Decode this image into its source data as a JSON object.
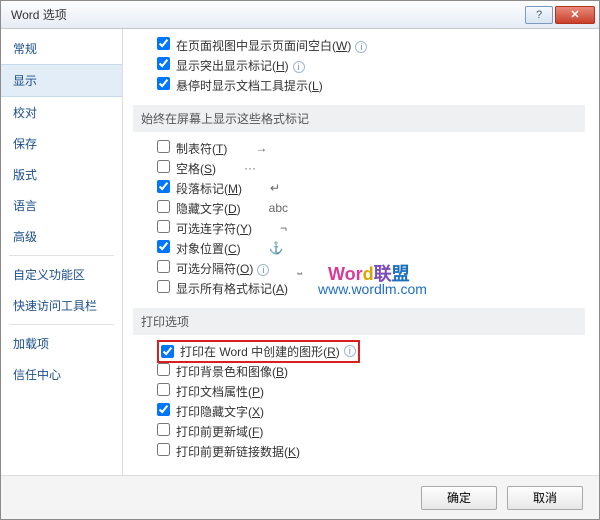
{
  "title": "Word 选项",
  "sidebar": {
    "items": [
      {
        "label": "常规"
      },
      {
        "label": "显示"
      },
      {
        "label": "校对"
      },
      {
        "label": "保存"
      },
      {
        "label": "版式"
      },
      {
        "label": "语言"
      },
      {
        "label": "高级"
      },
      {
        "label": "自定义功能区"
      },
      {
        "label": "快速访问工具栏"
      },
      {
        "label": "加载项"
      },
      {
        "label": "信任中心"
      }
    ]
  },
  "top_opts": [
    {
      "checked": true,
      "label": "在页面视图中显示页面间空白(",
      "key": "W",
      "tail": ")",
      "info": true
    },
    {
      "checked": true,
      "label": "显示突出显示标记(",
      "key": "H",
      "tail": ")",
      "info": true
    },
    {
      "checked": true,
      "label": "悬停时显示文档工具提示(",
      "key": "L",
      "tail": ")"
    }
  ],
  "section1": "始终在屏幕上显示这些格式标记",
  "fmt_opts": [
    {
      "checked": false,
      "label": "制表符(",
      "key": "T",
      "tail": ")",
      "sym": "→"
    },
    {
      "checked": false,
      "label": "空格(",
      "key": "S",
      "tail": ")",
      "sym": "···"
    },
    {
      "checked": true,
      "label": "段落标记(",
      "key": "M",
      "tail": ")",
      "sym": "↵"
    },
    {
      "checked": false,
      "label": "隐藏文字(",
      "key": "D",
      "tail": ")",
      "sym": "abc"
    },
    {
      "checked": false,
      "label": "可选连字符(",
      "key": "Y",
      "tail": ")",
      "sym": "¬"
    },
    {
      "checked": true,
      "label": "对象位置(",
      "key": "C",
      "tail": ")",
      "sym": "⚓"
    },
    {
      "checked": false,
      "label": "可选分隔符(",
      "key": "O",
      "tail": ")",
      "sym": "⎵",
      "info": true
    },
    {
      "checked": false,
      "label": "显示所有格式标记(",
      "key": "A",
      "tail": ")"
    }
  ],
  "section2": "打印选项",
  "print_opts": [
    {
      "checked": true,
      "label": "打印在 Word 中创建的图形(",
      "key": "R",
      "tail": ")",
      "info": true,
      "highlight": true
    },
    {
      "checked": false,
      "label": "打印背景色和图像(",
      "key": "B",
      "tail": ")"
    },
    {
      "checked": false,
      "label": "打印文档属性(",
      "key": "P",
      "tail": ")"
    },
    {
      "checked": true,
      "label": "打印隐藏文字(",
      "key": "X",
      "tail": ")"
    },
    {
      "checked": false,
      "label": "打印前更新域(",
      "key": "F",
      "tail": ")"
    },
    {
      "checked": false,
      "label": "打印前更新链接数据(",
      "key": "K",
      "tail": ")"
    }
  ],
  "footer": {
    "ok": "确定",
    "cancel": "取消"
  },
  "watermark": {
    "t1": "Wor",
    "t2": "d",
    "t3": "联",
    "t4": "盟",
    "url": "www.wordlm.com"
  }
}
